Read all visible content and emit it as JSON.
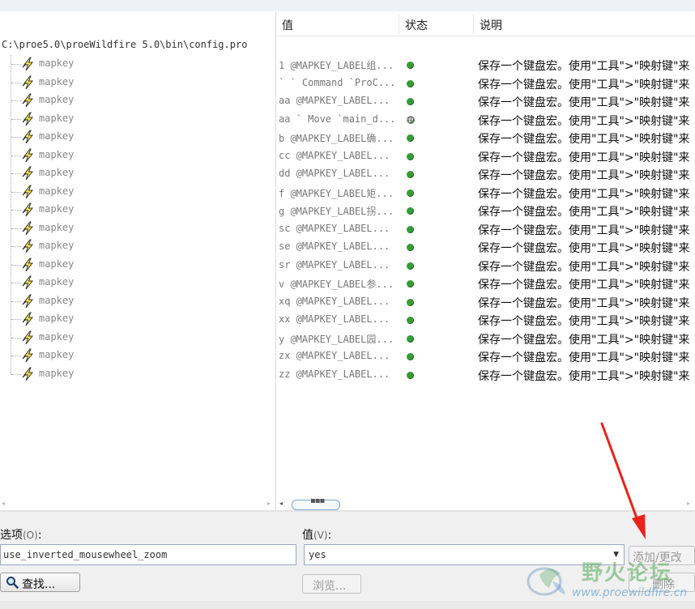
{
  "table": {
    "columns": {
      "value": "值",
      "status": "状态",
      "description": "说明"
    },
    "root_path": "C:\\proe5.0\\proeWildfire 5.0\\bin\\config.pro",
    "rows": [
      {
        "name": "mapkey",
        "value": "1 @MAPKEY_LABEL组...",
        "status": "ok",
        "description": "保存一个键盘宏。使用\"工具\">\"映射键\"来"
      },
      {
        "name": "mapkey",
        "value": "` ` Command `ProC...",
        "status": "ok",
        "description": "保存一个键盘宏。使用\"工具\">\"映射键\"来"
      },
      {
        "name": "mapkey",
        "value": "aa @MAPKEY_LABEL...",
        "status": "ok",
        "description": "保存一个键盘宏。使用\"工具\">\"映射键\"来"
      },
      {
        "name": "mapkey",
        "value": "aa ` Move `main_d...",
        "status": "pending",
        "description": "保存一个键盘宏。使用\"工具\">\"映射键\"来"
      },
      {
        "name": "mapkey",
        "value": "b @MAPKEY_LABEL确...",
        "status": "ok",
        "description": "保存一个键盘宏。使用\"工具\">\"映射键\"来"
      },
      {
        "name": "mapkey",
        "value": "cc @MAPKEY_LABEL...",
        "status": "ok",
        "description": "保存一个键盘宏。使用\"工具\">\"映射键\"来"
      },
      {
        "name": "mapkey",
        "value": "dd @MAPKEY_LABEL...",
        "status": "ok",
        "description": "保存一个键盘宏。使用\"工具\">\"映射键\"来"
      },
      {
        "name": "mapkey",
        "value": "f @MAPKEY_LABEL矩...",
        "status": "ok",
        "description": "保存一个键盘宏。使用\"工具\">\"映射键\"来"
      },
      {
        "name": "mapkey",
        "value": "g @MAPKEY_LABEL拐...",
        "status": "ok",
        "description": "保存一个键盘宏。使用\"工具\">\"映射键\"来"
      },
      {
        "name": "mapkey",
        "value": "sc @MAPKEY_LABEL...",
        "status": "ok",
        "description": "保存一个键盘宏。使用\"工具\">\"映射键\"来"
      },
      {
        "name": "mapkey",
        "value": "se @MAPKEY_LABEL...",
        "status": "ok",
        "description": "保存一个键盘宏。使用\"工具\">\"映射键\"来"
      },
      {
        "name": "mapkey",
        "value": "sr @MAPKEY_LABEL...",
        "status": "ok",
        "description": "保存一个键盘宏。使用\"工具\">\"映射键\"来"
      },
      {
        "name": "mapkey",
        "value": "v @MAPKEY_LABEL参...",
        "status": "ok",
        "description": "保存一个键盘宏。使用\"工具\">\"映射键\"来"
      },
      {
        "name": "mapkey",
        "value": "xq @MAPKEY_LABEL...",
        "status": "ok",
        "description": "保存一个键盘宏。使用\"工具\">\"映射键\"来"
      },
      {
        "name": "mapkey",
        "value": "xx @MAPKEY_LABEL...",
        "status": "ok",
        "description": "保存一个键盘宏。使用\"工具\">\"映射键\"来"
      },
      {
        "name": "mapkey",
        "value": "y @MAPKEY_LABEL园...",
        "status": "ok",
        "description": "保存一个键盘宏。使用\"工具\">\"映射键\"来"
      },
      {
        "name": "mapkey",
        "value": "zx @MAPKEY_LABEL...",
        "status": "ok",
        "description": "保存一个键盘宏。使用\"工具\">\"映射键\"来"
      },
      {
        "name": "mapkey",
        "value": "zz @MAPKEY_LABEL...",
        "status": "ok",
        "description": "保存一个键盘宏。使用\"工具\">\"映射键\"来"
      }
    ]
  },
  "scrollbar": {
    "grip": "▪▪▪"
  },
  "form": {
    "option_label": "选项",
    "option_key": "(O)",
    "option_colon": ":",
    "option_value": "use_inverted_mousewheel_zoom",
    "value_label": "值",
    "value_key": "(V)",
    "value_colon": ":",
    "value_selected": "yes",
    "find_button": "查找...",
    "browse_button": "浏览...",
    "add_change_button": "添加/更改",
    "delete_button": "删除"
  },
  "watermark": {
    "name": "野火论坛",
    "url": "www.proewildfire.cn"
  },
  "colors": {
    "status_ok": "#3a9a3a",
    "annotation_arrow": "#e8231b"
  }
}
